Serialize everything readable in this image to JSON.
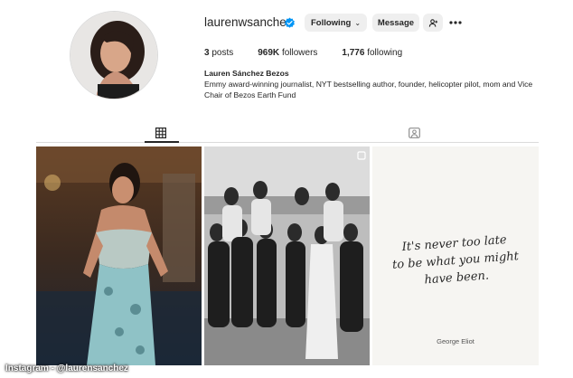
{
  "profile": {
    "username": "laurenwsanchez",
    "verified_color": "#0095f6",
    "following_label": "Following",
    "message_label": "Message"
  },
  "stats": {
    "posts_count": "3",
    "posts_label": "posts",
    "followers_count": "969K",
    "followers_label": "followers",
    "following_count": "1,776",
    "following_label": "following"
  },
  "bio": {
    "name": "Lauren Sánchez Bezos",
    "text": "Emmy award-winning journalist, NYT bestselling author, founder, helicopter pilot, mom and Vice Chair of Bezos Earth Fund"
  },
  "tabs": {
    "posts_icon": "grid-icon",
    "tagged_icon": "tagged-person-icon"
  },
  "posts": {
    "quote_lines": [
      "It's never too late",
      "to be what you might",
      "have been."
    ],
    "quote_author": "George Eliot"
  },
  "credit": "Instagram - @laurensanchez"
}
